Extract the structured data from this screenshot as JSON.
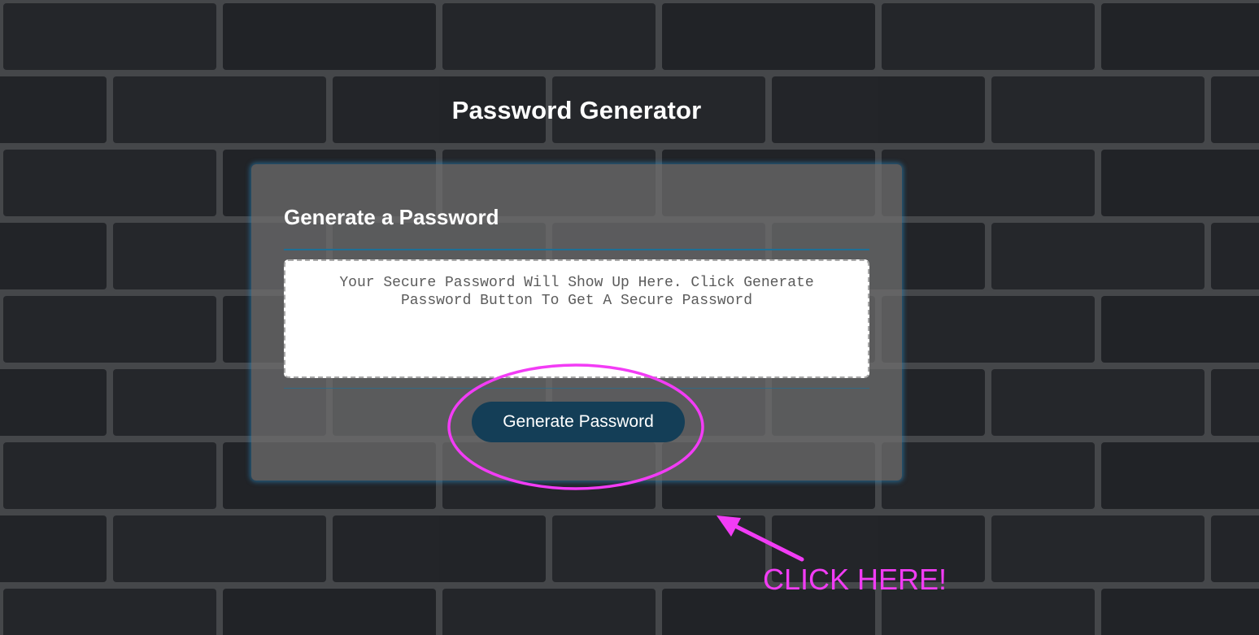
{
  "app": {
    "title": "Password Generator"
  },
  "card": {
    "heading": "Generate a Password",
    "password_placeholder": "Your Secure Password Will Show Up Here. Click Generate Password Button To Get A Secure Password",
    "password_value": "",
    "generate_button_label": "Generate Password"
  },
  "annotation": {
    "text": "CLICK HERE!",
    "color": "#f23cf5"
  },
  "colors": {
    "button_background": "#143e57",
    "card_glow": "#288cc8",
    "divider": "#1f6f95",
    "wall": "#1b1c1e"
  },
  "icons": {
    "annotation_circle": "ellipse-highlight",
    "annotation_arrow": "arrow-up-left-icon"
  }
}
